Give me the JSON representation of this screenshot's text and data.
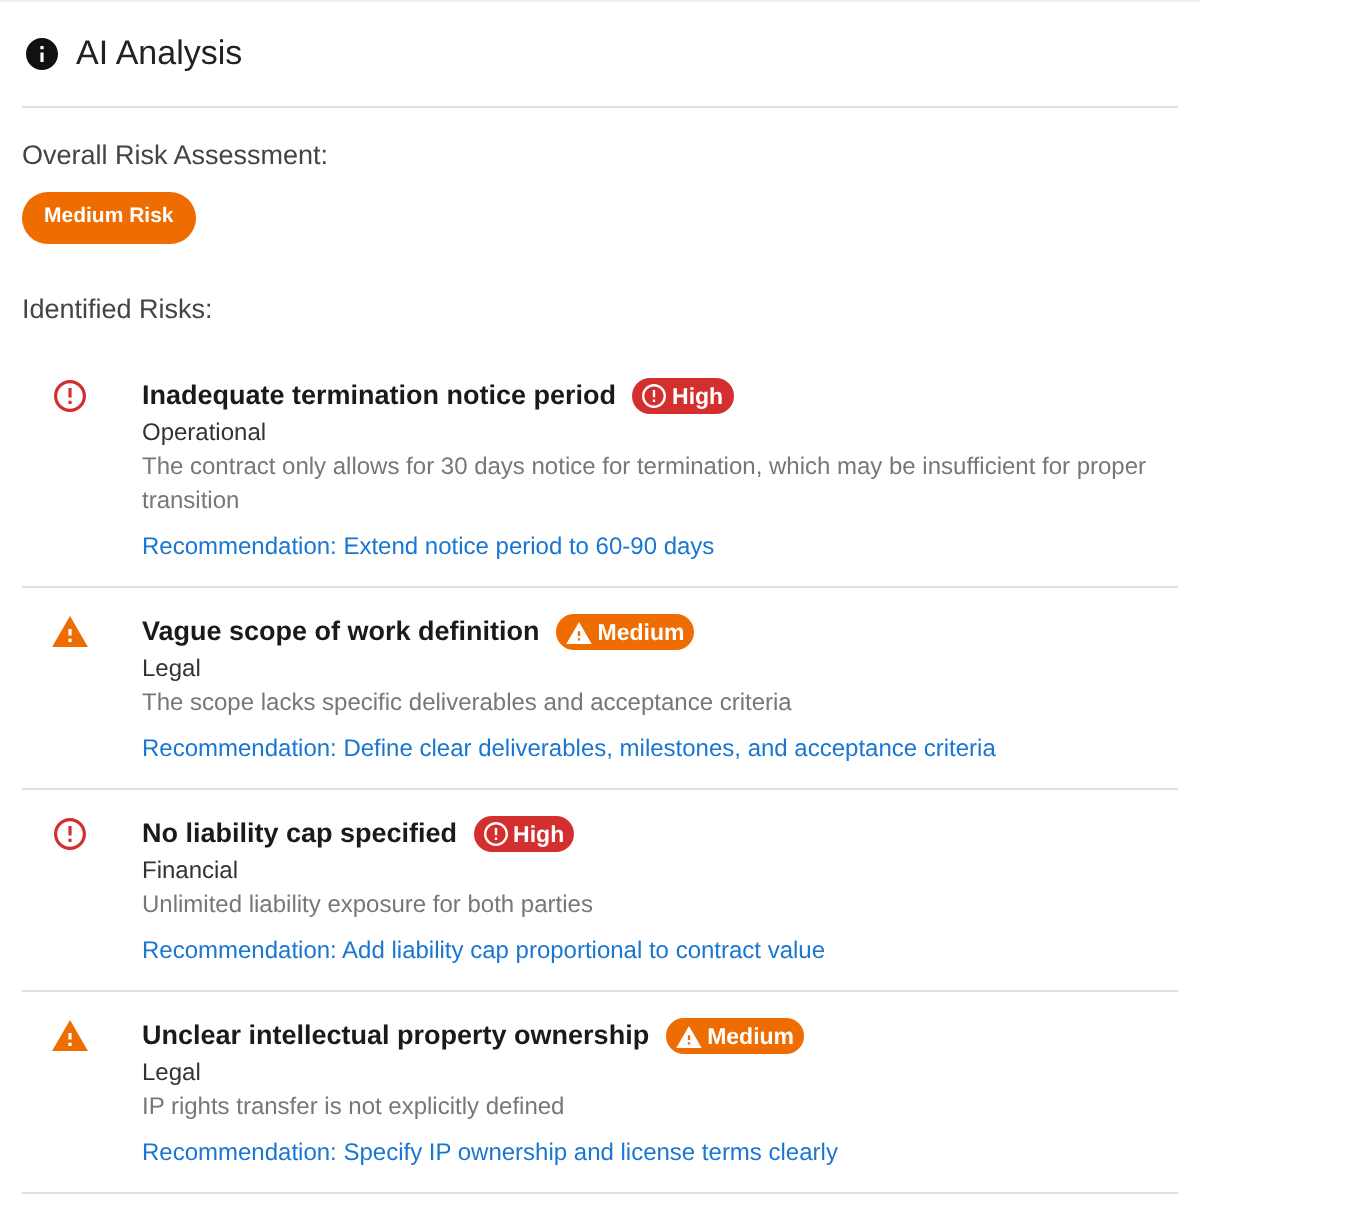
{
  "header": {
    "title": "AI Analysis"
  },
  "overall": {
    "label": "Overall Risk Assessment:",
    "badge": {
      "text": "Medium Risk",
      "kind": "medium"
    }
  },
  "risks_label": "Identified Risks:",
  "risks": [
    {
      "kind": "high",
      "title": "Inadequate termination notice period",
      "badge": "High",
      "category": "Operational",
      "description": "The contract only allows for 30 days notice for termination, which may be insufficient for proper transition",
      "recommendation": "Recommendation: Extend notice period to 60-90 days"
    },
    {
      "kind": "medium",
      "title": "Vague scope of work definition",
      "badge": "Medium",
      "category": "Legal",
      "description": "The scope lacks specific deliverables and acceptance criteria",
      "recommendation": "Recommendation: Define clear deliverables, milestones, and acceptance criteria"
    },
    {
      "kind": "high",
      "title": "No liability cap specified",
      "badge": "High",
      "category": "Financial",
      "description": "Unlimited liability exposure for both parties",
      "recommendation": "Recommendation: Add liability cap proportional to contract value"
    },
    {
      "kind": "medium",
      "title": "Unclear intellectual property ownership",
      "badge": "Medium",
      "category": "Legal",
      "description": "IP rights transfer is not explicitly defined",
      "recommendation": "Recommendation: Specify IP ownership and license terms clearly"
    }
  ]
}
